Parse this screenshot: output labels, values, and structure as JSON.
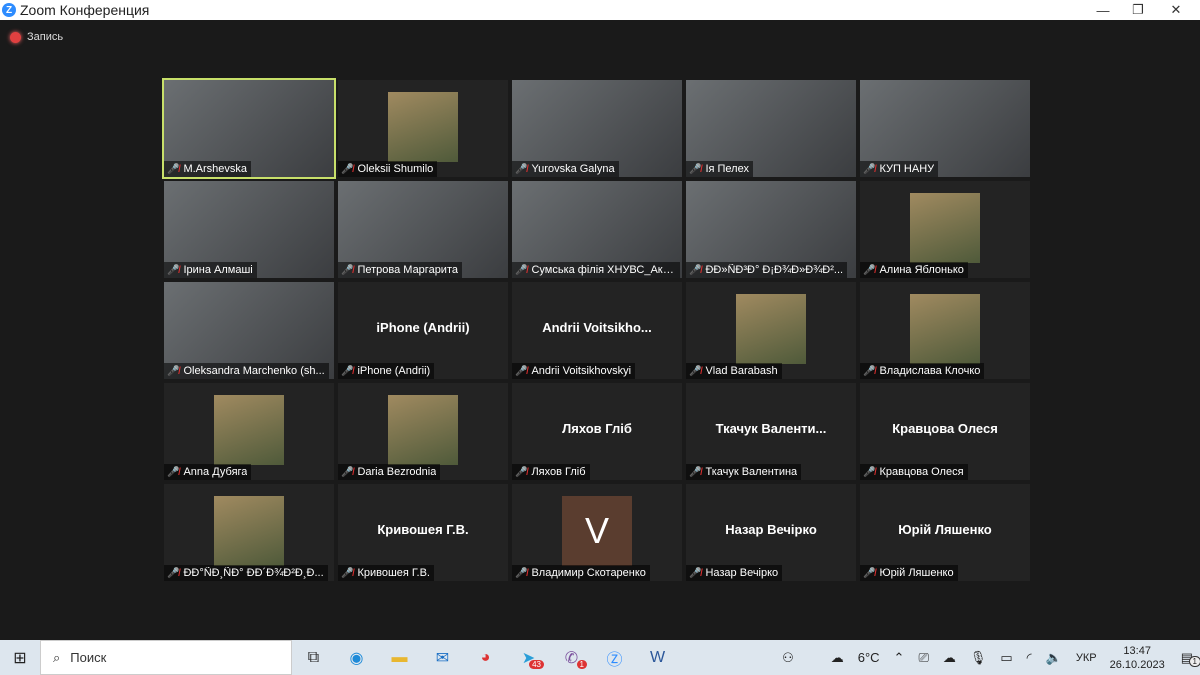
{
  "window": {
    "title": "Zoom Конференция",
    "minimize": "—",
    "maximize": "❐",
    "close": "✕"
  },
  "recording": {
    "label": "Запись"
  },
  "tiles": [
    {
      "name": "M.Arshevska",
      "kind": "video",
      "active": true
    },
    {
      "name": "Oleksii Shumilo",
      "kind": "thumb"
    },
    {
      "name": "Yurovska Galyna",
      "kind": "video"
    },
    {
      "name": "Ія Пелех",
      "kind": "video"
    },
    {
      "name": "КУП НАНУ",
      "kind": "video"
    },
    {
      "name": "Ірина Алмаші",
      "kind": "video"
    },
    {
      "name": "Петрова Маргарита",
      "kind": "video"
    },
    {
      "name": "Сумська філія ХНУВС_Акад...",
      "kind": "video"
    },
    {
      "name": "ÐÐ»ÑÐ³Ð° Ð¡Ð¾Ð»Ð¾Ð²...",
      "kind": "video"
    },
    {
      "name": "Алина Яблонько",
      "kind": "thumb"
    },
    {
      "name": "Oleksandra Marchenko (sh...",
      "kind": "video"
    },
    {
      "name": "iPhone (Andrii)",
      "kind": "text",
      "big": "iPhone (Andrii)"
    },
    {
      "name": "Andrii Voitsikhovskyi",
      "kind": "text",
      "big": "Andrii  Voitsikho..."
    },
    {
      "name": "Vlad Barabash",
      "kind": "thumb"
    },
    {
      "name": "Владислава Клочко",
      "kind": "thumb"
    },
    {
      "name": "Anna Дубяга",
      "kind": "thumb"
    },
    {
      "name": "Daria Bezrodnia",
      "kind": "thumb"
    },
    {
      "name": "Ляхов Гліб",
      "kind": "text",
      "big": "Ляхов Гліб"
    },
    {
      "name": "Ткачук Валентина",
      "kind": "text",
      "big": "Ткачук  Валенти..."
    },
    {
      "name": "Кравцова Олеся",
      "kind": "text",
      "big": "Кравцова Олеся"
    },
    {
      "name": "ÐÐ°ÑÐ¸ÑÐ° ÐÐ´Ð¾Ð²Ð¸Ð...",
      "kind": "thumb"
    },
    {
      "name": "Кривошея Г.В.",
      "kind": "text",
      "big": "Кривошея Г.В."
    },
    {
      "name": "Владимир Скотаренко",
      "kind": "letter",
      "big": "V"
    },
    {
      "name": "Назар Вечірко",
      "kind": "text",
      "big": "Назар Вечірко"
    },
    {
      "name": "Юрій Ляшенко",
      "kind": "text",
      "big": "Юрій Ляшенко"
    }
  ],
  "taskbar": {
    "search": "Поиск",
    "telegram_badge": "43",
    "viber_badge": "1",
    "weather": "6°C",
    "lang": "УКР",
    "time": "13:47",
    "date": "26.10.2023",
    "notif": "1"
  }
}
